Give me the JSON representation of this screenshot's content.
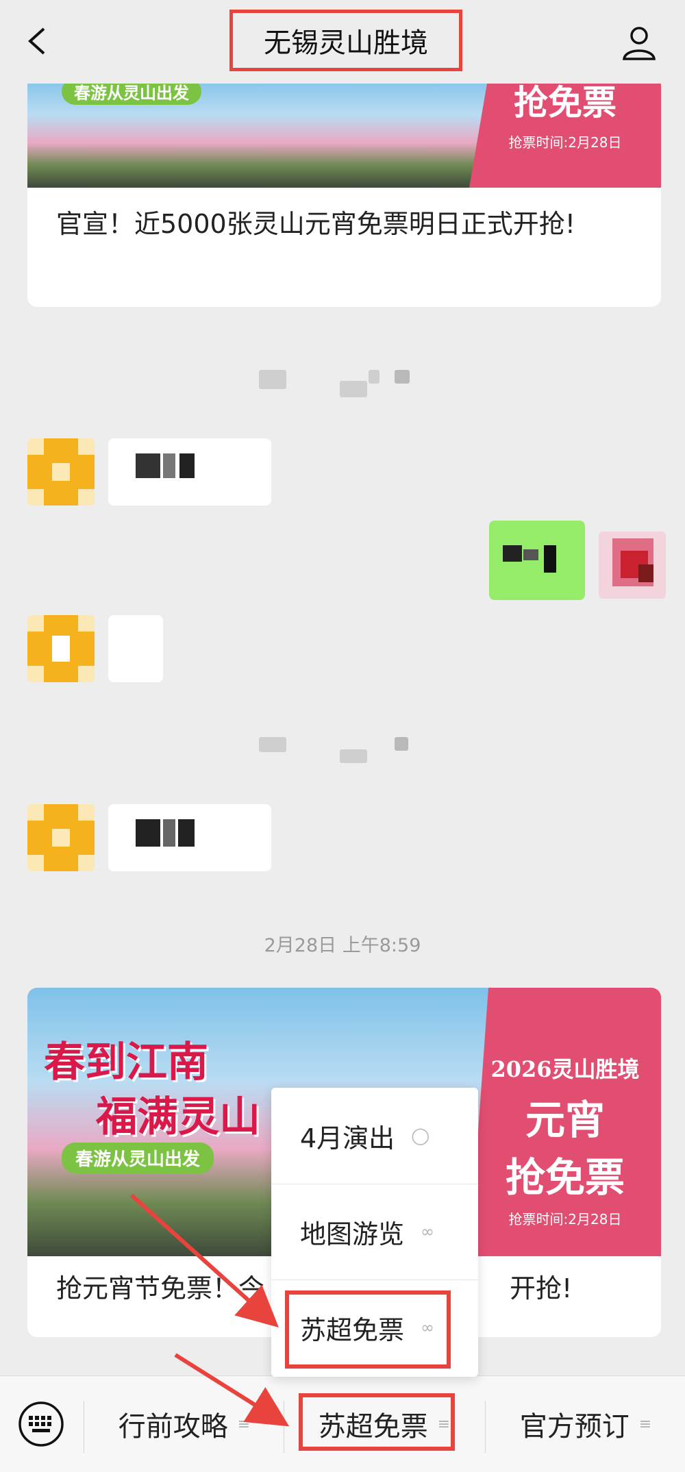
{
  "header": {
    "title": "无锡灵山胜境",
    "back_icon": "chevron-left-icon",
    "profile_icon": "user-icon"
  },
  "card_top": {
    "banner_badge": "抢免票",
    "banner_time": "抢票时间:2月28日",
    "banner_slogan": "春游从灵山出发",
    "title": "官宣！近5000张灵山元宵免票明日正式开抢!"
  },
  "chat": {
    "timestamp": "2月28日 上午8:59"
  },
  "card_bottom": {
    "banner_headline_1": "春到江南",
    "banner_headline_2": "福满灵山",
    "banner_slogan": "春游从灵山出发",
    "banner_year": "2026灵山胜境",
    "banner_line1": "元宵",
    "banner_line2": "抢免票",
    "banner_time": "抢票时间:2月28日",
    "title_left": "抢元宵节免票！今",
    "title_right": "开抢!"
  },
  "popup": {
    "items": [
      {
        "label": "4月演出",
        "icon": "chat-bubble-icon"
      },
      {
        "label": "地图游览",
        "icon": "mini-program-icon"
      },
      {
        "label": "苏超免票",
        "icon": "mini-program-icon"
      }
    ]
  },
  "bottom_menu": {
    "keyboard_icon": "keyboard-icon",
    "items": [
      {
        "label": "行前攻略"
      },
      {
        "label": "苏超免票"
      },
      {
        "label": "官方预订"
      }
    ]
  },
  "colors": {
    "highlight": "#e8443d",
    "banner_pink": "#e24e71",
    "sent_bubble": "#95ec69"
  }
}
